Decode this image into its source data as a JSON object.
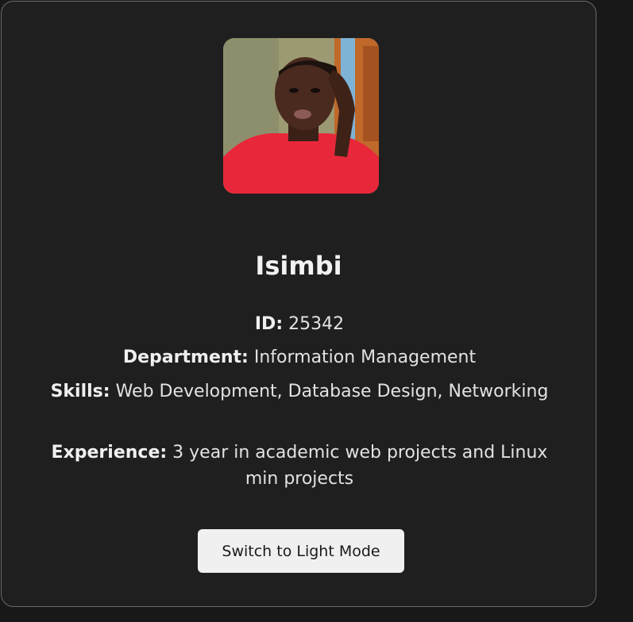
{
  "profile": {
    "photo_alt": "Profile photo",
    "name": "Isimbi",
    "id_label": "ID:",
    "id_value": "25342",
    "department_label": "Department:",
    "department_value": "Information Management",
    "skills_label": "Skills:",
    "skills_value": "Web Development, Database Design, Networking",
    "experience_label": "Experience:",
    "experience_value": "3 year in academic web projects and Linux min projects"
  },
  "theme_toggle": {
    "label": "Switch to Light Mode"
  },
  "colors": {
    "page_background": "#181818",
    "card_background": "#1f1f1f",
    "card_border": "#6a6a6a",
    "button_background": "#f0f0f0"
  }
}
